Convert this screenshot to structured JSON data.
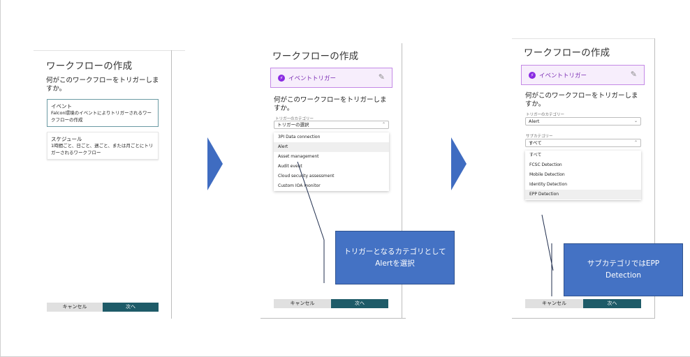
{
  "common": {
    "title": "ワークフローの作成",
    "question": "何がこのワークフローをトリガーしますか。",
    "cancel_label": "キャンセル",
    "next_label": "次へ"
  },
  "screen1": {
    "options": [
      {
        "title": "イベント",
        "desc": "Falcon環境のイベントによりトリガーされるワークフローの作成"
      },
      {
        "title": "スケジュール",
        "desc": "1時間ごと、日ごと、週ごと、または月ごとにトリガーされるワークフロー"
      }
    ]
  },
  "screen2": {
    "trigger_label": "イベントトリガー",
    "category_label": "トリガーのカテゴリー",
    "category_value": "トリガーの選択",
    "dropdown": [
      "3PI Data connection",
      "Alert",
      "Asset management",
      "Audit event",
      "Cloud security assessment",
      "Custom IOA monitor"
    ],
    "callout": "トリガーとなるカテゴリとしてAlertを選択"
  },
  "screen3": {
    "trigger_label": "イベントトリガー",
    "category_label": "トリガーのカテゴリー",
    "category_value": "Alert",
    "subcategory_label": "サブカテゴリー",
    "subcategory_value": "すべて",
    "dropdown": [
      "すべて",
      "FCSC Detection",
      "Mobile Detection",
      "Identity Detection",
      "EPP Detection"
    ],
    "callout": "サブカテゴリではEPP Detection"
  },
  "icons": {
    "bolt": "⚡",
    "pencil": "✎",
    "chevron_down": "⌄",
    "chevron_up": "⌃"
  },
  "colors": {
    "primary_button": "#1e5b68",
    "trigger_accent": "#8a2be2",
    "callout": "#4472c4"
  }
}
